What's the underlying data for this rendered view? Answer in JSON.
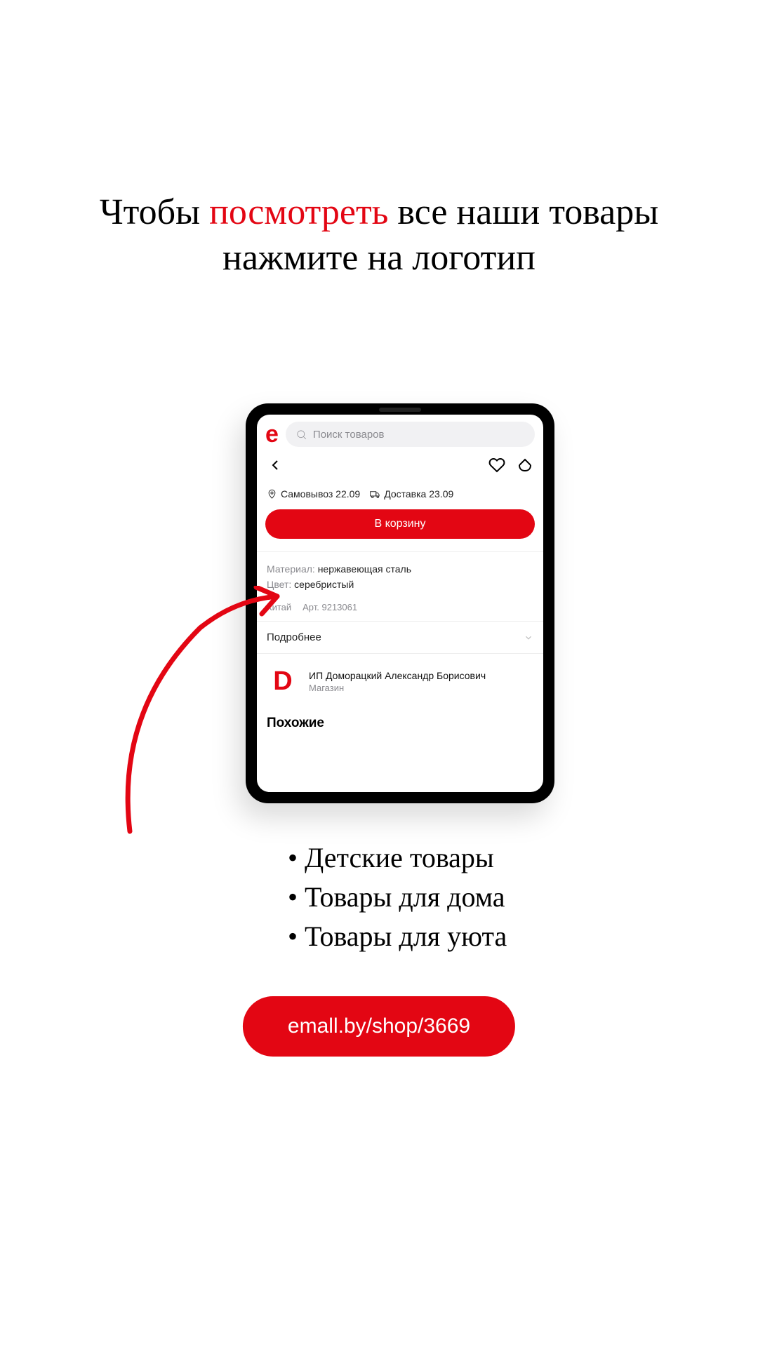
{
  "heading": {
    "part1": "Чтобы ",
    "accent": "посмотреть",
    "part2": " все наши товары",
    "line2": "нажмите на логотип"
  },
  "app": {
    "logo": "e",
    "search_placeholder": "Поиск товаров",
    "pickup_label": "Самовывоз 22.09",
    "delivery_label": "Доставка 23.09",
    "cart_button": "В корзину",
    "spec_material_label": "Материал:",
    "spec_material_value": "нержавеющая сталь",
    "spec_color_label": "Цвет:",
    "spec_color_value": "серебристый",
    "country": "Китай",
    "article": "Арт. 9213061",
    "more_label": "Подробнее",
    "shop_logo": "D",
    "shop_name": "ИП Доморацкий Александр Борисович",
    "shop_sub": "Магазин",
    "similar_label": "Похожие"
  },
  "bullets": {
    "item1": "Детские товары",
    "item2": "Товары для дома",
    "item3": "Товары для уюта"
  },
  "cta": {
    "url": "emall.by/shop/3669"
  }
}
